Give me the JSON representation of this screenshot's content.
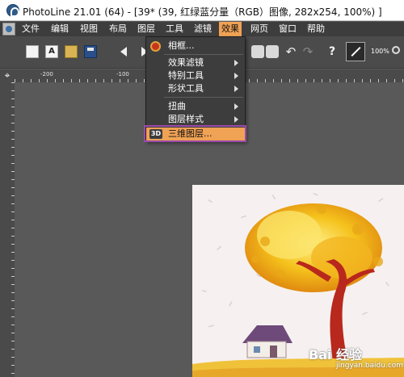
{
  "window": {
    "title": "PhotoLine 21.01 (64) - [39* (39, 红绿蓝分量（RGB）图像, 282x254, 100%) ]"
  },
  "menubar": {
    "items": [
      "文件",
      "编辑",
      "视图",
      "布局",
      "图层",
      "工具",
      "滤镜",
      "效果",
      "网页",
      "窗口",
      "帮助"
    ],
    "active": "效果"
  },
  "toolbar": {
    "zoom_label": "100%"
  },
  "ruler": {
    "labels": [
      "-200",
      "-100"
    ]
  },
  "effects_menu": {
    "items": [
      {
        "label": "相框...",
        "icon": "frame-icon",
        "submenu": false
      },
      {
        "label": "效果滤镜",
        "submenu": true
      },
      {
        "label": "特别工具",
        "submenu": true
      },
      {
        "label": "形状工具",
        "submenu": true
      },
      {
        "label": "扭曲",
        "submenu": true
      },
      {
        "label": "图层样式",
        "submenu": true
      },
      {
        "label": "三维图层...",
        "icon": "3d-icon",
        "icon_text": "3D",
        "submenu": false,
        "highlighted": true
      }
    ]
  },
  "watermark": {
    "brand": "Bai 经验",
    "url": "jingyan.baidu.com"
  },
  "colors": {
    "accent": "#f0a255",
    "annotation": "#9b4aa8",
    "menubar": "#3d3d3d",
    "canvas": "#595959"
  }
}
